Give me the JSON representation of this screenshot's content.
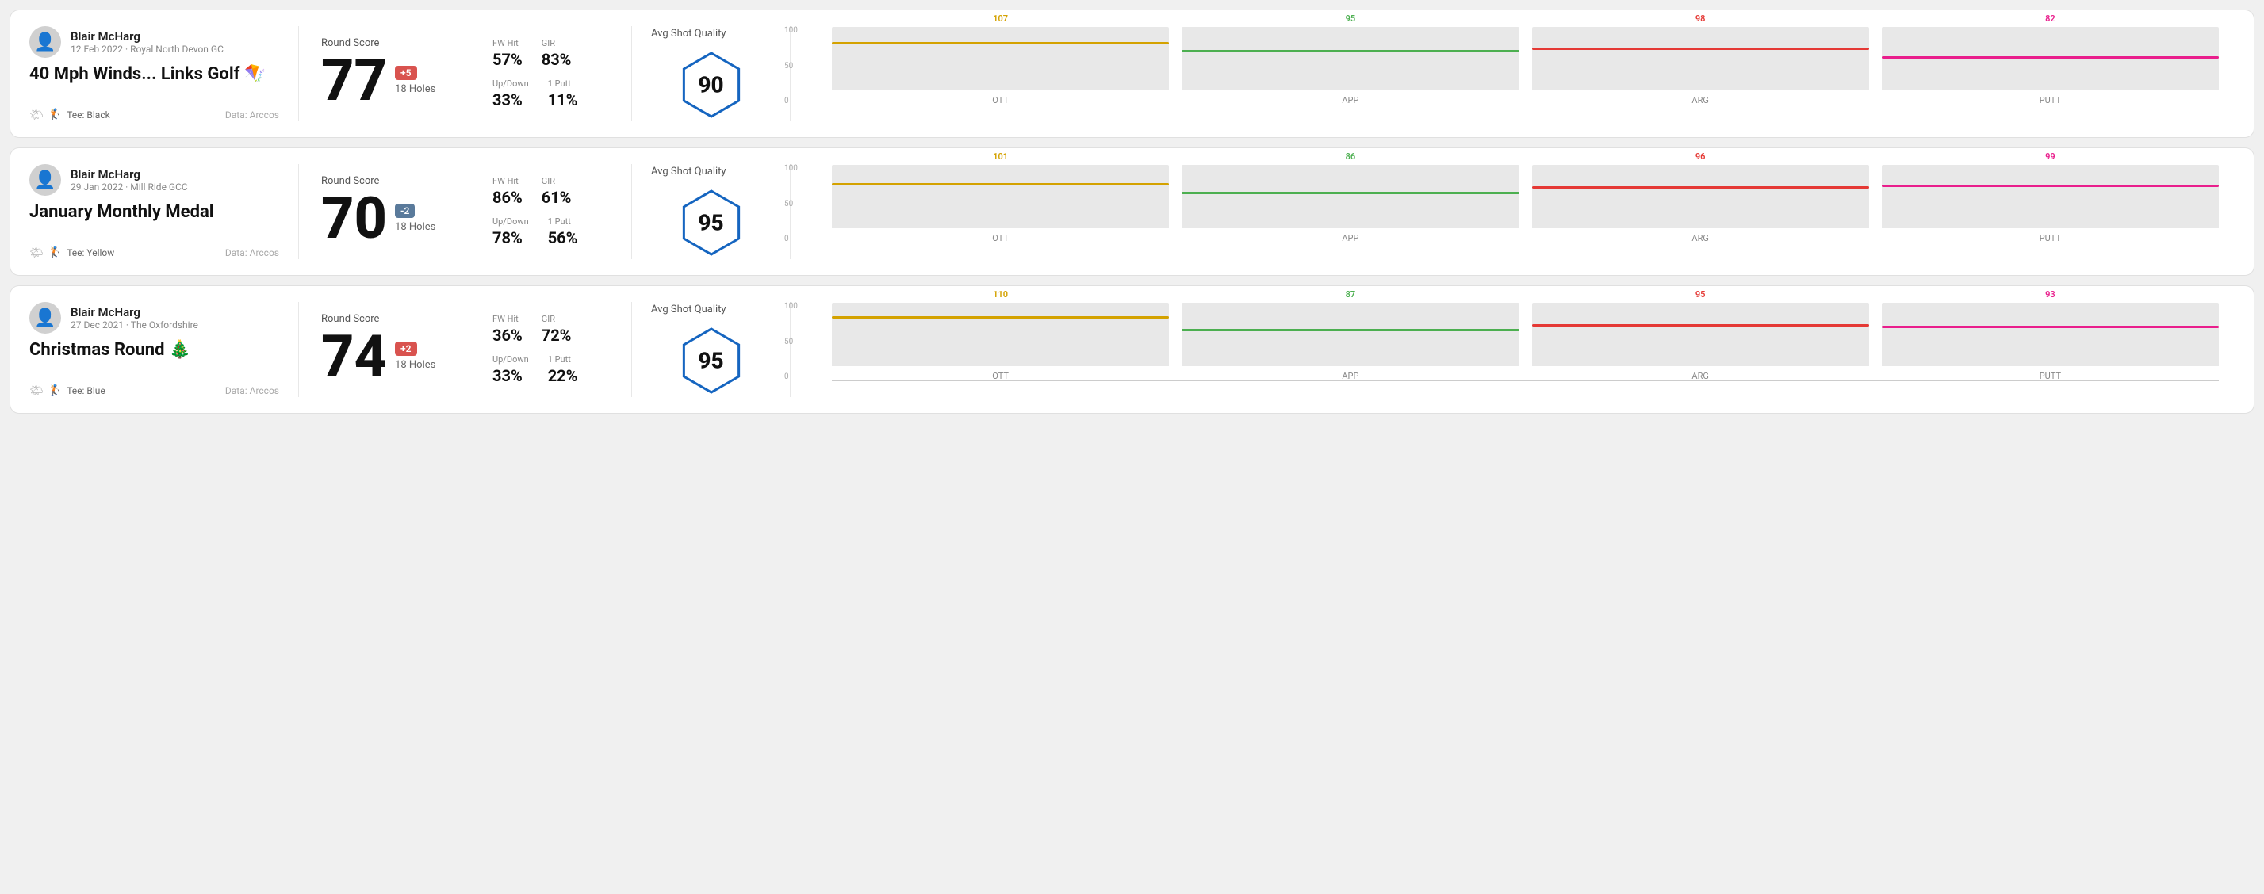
{
  "rounds": [
    {
      "id": "round1",
      "user": {
        "name": "Blair McHarg",
        "meta": "12 Feb 2022 · Royal North Devon GC"
      },
      "title": "40 Mph Winds... Links Golf 🪁",
      "tee": "Black",
      "data_source": "Data: Arccos",
      "score": {
        "label": "Round Score",
        "number": "77",
        "badge": "+5",
        "badge_type": "positive",
        "holes": "18 Holes"
      },
      "stats": {
        "fw_hit_label": "FW Hit",
        "fw_hit_value": "57%",
        "gir_label": "GIR",
        "gir_value": "83%",
        "updown_label": "Up/Down",
        "updown_value": "33%",
        "one_putt_label": "1 Putt",
        "one_putt_value": "11%"
      },
      "quality": {
        "label": "Avg Shot Quality",
        "score": "90"
      },
      "chart": {
        "bars": [
          {
            "label": "OTT",
            "value": 107,
            "color": "#d4a200",
            "bar_pct": 72
          },
          {
            "label": "APP",
            "value": 95,
            "color": "#4caf50",
            "bar_pct": 60
          },
          {
            "label": "ARG",
            "value": 98,
            "color": "#e53935",
            "bar_pct": 64
          },
          {
            "label": "PUTT",
            "value": 82,
            "color": "#e91e8c",
            "bar_pct": 50
          }
        ],
        "y_labels": [
          "100",
          "50",
          "0"
        ]
      }
    },
    {
      "id": "round2",
      "user": {
        "name": "Blair McHarg",
        "meta": "29 Jan 2022 · Mill Ride GCC"
      },
      "title": "January Monthly Medal",
      "tee": "Yellow",
      "data_source": "Data: Arccos",
      "score": {
        "label": "Round Score",
        "number": "70",
        "badge": "-2",
        "badge_type": "negative",
        "holes": "18 Holes"
      },
      "stats": {
        "fw_hit_label": "FW Hit",
        "fw_hit_value": "86%",
        "gir_label": "GIR",
        "gir_value": "61%",
        "updown_label": "Up/Down",
        "updown_value": "78%",
        "one_putt_label": "1 Putt",
        "one_putt_value": "56%"
      },
      "quality": {
        "label": "Avg Shot Quality",
        "score": "95"
      },
      "chart": {
        "bars": [
          {
            "label": "OTT",
            "value": 101,
            "color": "#d4a200",
            "bar_pct": 68
          },
          {
            "label": "APP",
            "value": 86,
            "color": "#4caf50",
            "bar_pct": 54
          },
          {
            "label": "ARG",
            "value": 96,
            "color": "#e53935",
            "bar_pct": 63
          },
          {
            "label": "PUTT",
            "value": 99,
            "color": "#e91e8c",
            "bar_pct": 65
          }
        ],
        "y_labels": [
          "100",
          "50",
          "0"
        ]
      }
    },
    {
      "id": "round3",
      "user": {
        "name": "Blair McHarg",
        "meta": "27 Dec 2021 · The Oxfordshire"
      },
      "title": "Christmas Round 🎄",
      "tee": "Blue",
      "data_source": "Data: Arccos",
      "score": {
        "label": "Round Score",
        "number": "74",
        "badge": "+2",
        "badge_type": "positive",
        "holes": "18 Holes"
      },
      "stats": {
        "fw_hit_label": "FW Hit",
        "fw_hit_value": "36%",
        "gir_label": "GIR",
        "gir_value": "72%",
        "updown_label": "Up/Down",
        "updown_value": "33%",
        "one_putt_label": "1 Putt",
        "one_putt_value": "22%"
      },
      "quality": {
        "label": "Avg Shot Quality",
        "score": "95"
      },
      "chart": {
        "bars": [
          {
            "label": "OTT",
            "value": 110,
            "color": "#d4a200",
            "bar_pct": 75
          },
          {
            "label": "APP",
            "value": 87,
            "color": "#4caf50",
            "bar_pct": 55
          },
          {
            "label": "ARG",
            "value": 95,
            "color": "#e53935",
            "bar_pct": 62
          },
          {
            "label": "PUTT",
            "value": 93,
            "color": "#e91e8c",
            "bar_pct": 60
          }
        ],
        "y_labels": [
          "100",
          "50",
          "0"
        ]
      }
    }
  ]
}
